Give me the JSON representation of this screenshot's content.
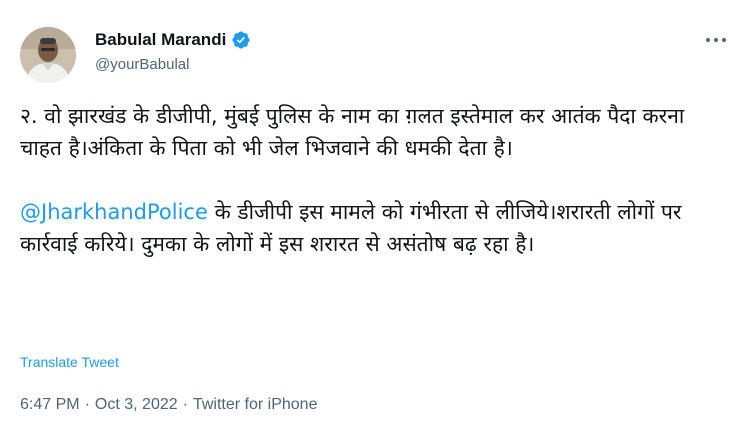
{
  "author": {
    "display_name": "Babulal Marandi",
    "handle": "@yourBabulal",
    "verified": true,
    "verified_badge_color": "#1d9bf0"
  },
  "icons": {
    "verified": "verified-badge-icon",
    "more": "more-horizontal-icon"
  },
  "tweet": {
    "paragraph1": "२. वो झारखंड के डीजीपी, मुंबई पुलिस के नाम का ग़लत इस्तेमाल कर आतंक पैदा करना चाहत है।अंकिता के पिता को भी जेल भिजवाने की धमकी देता है।",
    "mention": "@JharkhandPolice",
    "paragraph2_rest": " के डीजीपी इस मामले को गंभीरता से लीजिये।शरारती लोगों पर कार्रवाई करिये। दुमका के लोगों में इस शरारत से असंतोष बढ़ रहा है।",
    "translate_label": "Translate Tweet"
  },
  "meta": {
    "time": "6:47 PM",
    "separator1": "·",
    "date": "Oct 3, 2022",
    "separator2": "·",
    "source": "Twitter for iPhone"
  },
  "colors": {
    "text": "#0f1419",
    "secondary": "#536471",
    "accent": "#1d9bf0"
  }
}
